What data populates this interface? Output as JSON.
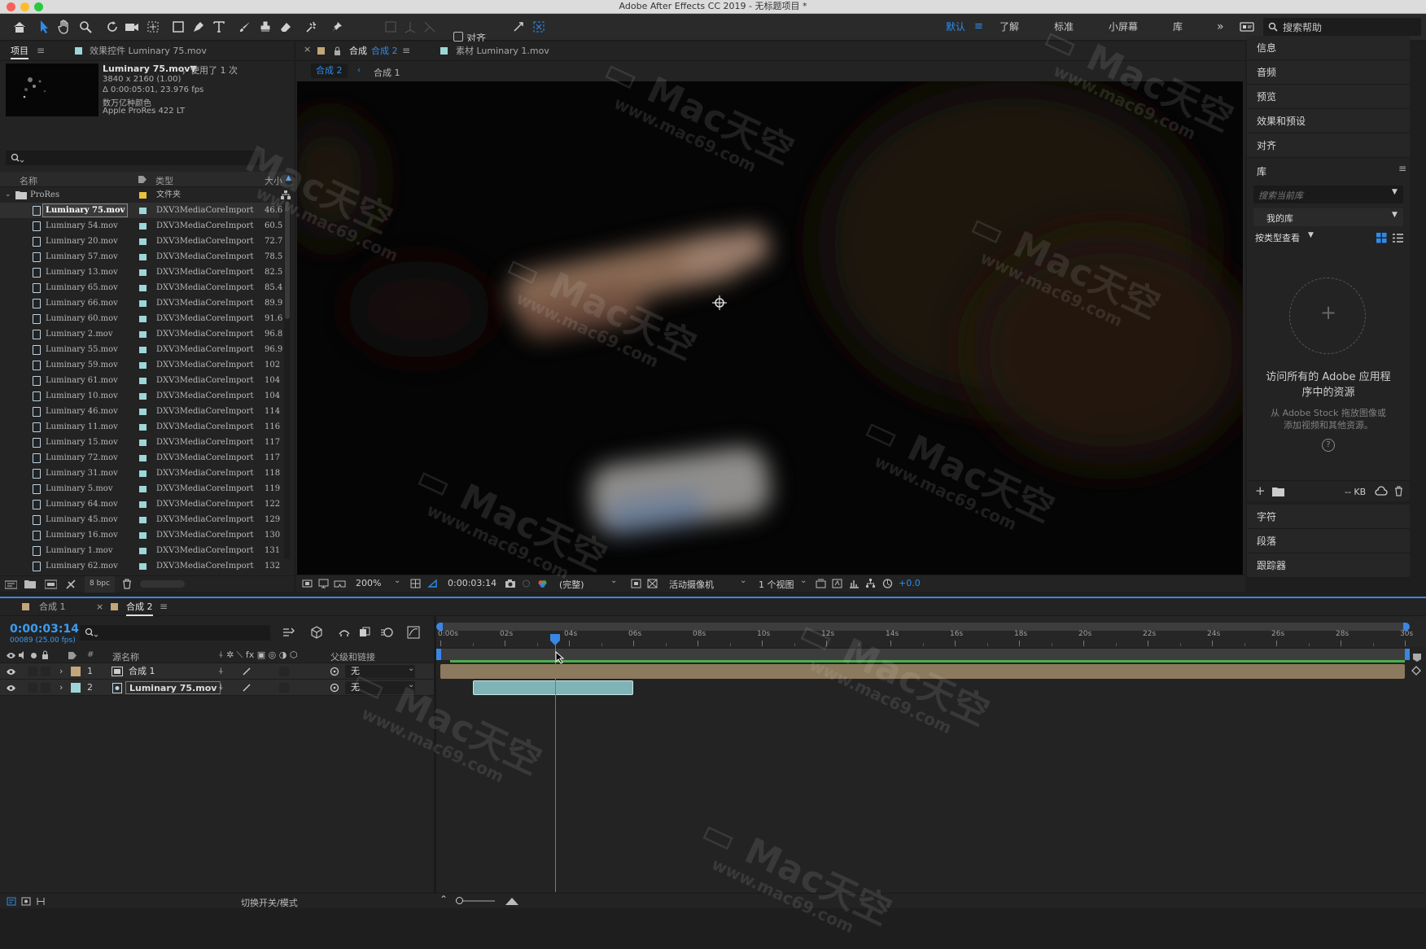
{
  "window": {
    "title": "Adobe After Effects CC 2019 - 无标题项目 *"
  },
  "colors": {
    "accent": "#2d8ceb",
    "comp_swatch": "#c2a57a",
    "footage_swatch": "#9ed6d8",
    "folder_swatch": "#e8c33a",
    "playhead": "#3a86e4",
    "work_area": "#4caf50"
  },
  "toolbar": {
    "tools": [
      "home-icon",
      "selection-tool-icon",
      "hand-tool-icon",
      "zoom-tool-icon",
      "rotate-tool-icon",
      "camera-tool-icon",
      "pan-behind-tool-icon",
      "rectangle-tool-icon",
      "pen-tool-icon",
      "type-tool-icon",
      "brush-tool-icon",
      "clone-stamp-tool-icon",
      "eraser-tool-icon",
      "roto-brush-icon",
      "puppet-pin-icon"
    ],
    "align_label": "对齐",
    "workspaces": [
      {
        "label": "默认",
        "active": true
      },
      {
        "label": "了解",
        "active": false
      },
      {
        "label": "标准",
        "active": false
      },
      {
        "label": "小屏幕",
        "active": false
      },
      {
        "label": "库",
        "active": false
      }
    ],
    "more": "»",
    "search_placeholder": "搜索帮助"
  },
  "project_panel": {
    "tab_project": "项目",
    "tab_effects": "效果控件 Luminary 75.mov",
    "preview": {
      "name": "Luminary 75.mov▼",
      "usage": "，使用了 1 次",
      "dimensions": "3840 x 2160 (1.00)",
      "duration": "Δ 0:00:05:01, 23.976 fps",
      "colors": "数万亿种颜色",
      "codec": "Apple ProRes 422 LT"
    },
    "search_placeholder": "",
    "columns": {
      "name": "名称",
      "type": "类型",
      "size": "大小"
    },
    "folder": {
      "name": "ProRes",
      "type": "文件夹"
    },
    "items": [
      {
        "name": "Luminary 75.mov",
        "type": "DXV3MediaCoreImport",
        "size": "46.6",
        "selected": true
      },
      {
        "name": "Luminary 54.mov",
        "type": "DXV3MediaCoreImport",
        "size": "60.5"
      },
      {
        "name": "Luminary 20.mov",
        "type": "DXV3MediaCoreImport",
        "size": "72.7"
      },
      {
        "name": "Luminary 57.mov",
        "type": "DXV3MediaCoreImport",
        "size": "78.5"
      },
      {
        "name": "Luminary 13.mov",
        "type": "DXV3MediaCoreImport",
        "size": "82.5"
      },
      {
        "name": "Luminary 65.mov",
        "type": "DXV3MediaCoreImport",
        "size": "85.4"
      },
      {
        "name": "Luminary 66.mov",
        "type": "DXV3MediaCoreImport",
        "size": "89.9"
      },
      {
        "name": "Luminary 60.mov",
        "type": "DXV3MediaCoreImport",
        "size": "91.6"
      },
      {
        "name": "Luminary 2.mov",
        "type": "DXV3MediaCoreImport",
        "size": "96.8"
      },
      {
        "name": "Luminary 55.mov",
        "type": "DXV3MediaCoreImport",
        "size": "96.9"
      },
      {
        "name": "Luminary 59.mov",
        "type": "DXV3MediaCoreImport",
        "size": "102"
      },
      {
        "name": "Luminary 61.mov",
        "type": "DXV3MediaCoreImport",
        "size": "104"
      },
      {
        "name": "Luminary 10.mov",
        "type": "DXV3MediaCoreImport",
        "size": "104"
      },
      {
        "name": "Luminary 46.mov",
        "type": "DXV3MediaCoreImport",
        "size": "114"
      },
      {
        "name": "Luminary 11.mov",
        "type": "DXV3MediaCoreImport",
        "size": "116"
      },
      {
        "name": "Luminary 15.mov",
        "type": "DXV3MediaCoreImport",
        "size": "117"
      },
      {
        "name": "Luminary 72.mov",
        "type": "DXV3MediaCoreImport",
        "size": "117"
      },
      {
        "name": "Luminary 31.mov",
        "type": "DXV3MediaCoreImport",
        "size": "118"
      },
      {
        "name": "Luminary 5.mov",
        "type": "DXV3MediaCoreImport",
        "size": "119"
      },
      {
        "name": "Luminary 64.mov",
        "type": "DXV3MediaCoreImport",
        "size": "122"
      },
      {
        "name": "Luminary 45.mov",
        "type": "DXV3MediaCoreImport",
        "size": "129"
      },
      {
        "name": "Luminary 16.mov",
        "type": "DXV3MediaCoreImport",
        "size": "130"
      },
      {
        "name": "Luminary 1.mov",
        "type": "DXV3MediaCoreImport",
        "size": "131"
      },
      {
        "name": "Luminary 62.mov",
        "type": "DXV3MediaCoreImport",
        "size": "132"
      }
    ],
    "bpc": "8 bpc"
  },
  "comp_viewer": {
    "tab_comp": "合成 合成 2",
    "tab_comp_prefix": "合成",
    "tab_comp_name": "合成 2",
    "tab_footage": "素材 Luminary 1.mov",
    "breadcrumb": [
      "合成 2",
      "合成 1"
    ],
    "zoom": "200%",
    "timecode": "0:00:03:14",
    "resolution": "(完整)",
    "camera": "活动摄像机",
    "views": "1 个视图",
    "exposure": "+0.0"
  },
  "right_panel": {
    "items_top": [
      "信息",
      "音频",
      "预览",
      "效果和预设",
      "对齐"
    ],
    "library": {
      "title": "库",
      "search_placeholder": "搜索当前库",
      "my_library": "我的库",
      "view_by": "按类型查看",
      "headline": "访问所有的 Adobe 应用程序中的资源",
      "sub": "从 Adobe Stock 拖放图像或添加视频和其他资源。",
      "size": "-- KB"
    },
    "items_bottom": [
      "字符",
      "段落",
      "跟踪器"
    ]
  },
  "timeline": {
    "tabs": [
      {
        "label": "合成 1",
        "active": false
      },
      {
        "label": "合成 2",
        "active": true
      }
    ],
    "timecode": "0:00:03:14",
    "frame_info": "00089 (25.00 fps)",
    "columns": {
      "num": "#",
      "source": "源名称",
      "parent": "父级和链接"
    },
    "layers": [
      {
        "num": "1",
        "name": "合成 1",
        "parent": "无",
        "type": "comp"
      },
      {
        "num": "2",
        "name": "Luminary 75.mov",
        "parent": "无",
        "type": "footage"
      }
    ],
    "ruler": [
      "0:00s",
      "02s",
      "04s",
      "06s",
      "08s",
      "10s",
      "12s",
      "14s",
      "16s",
      "18s",
      "20s",
      "22s",
      "24s",
      "26s",
      "28s",
      "30s"
    ],
    "playhead_seconds": 3.56,
    "duration_seconds": 30,
    "layer2_in": 1.0,
    "layer2_out": 6.0,
    "footer_toggle": "切换开关/模式"
  },
  "watermark": {
    "brand": "Mac天空",
    "url": "www.mac69.com"
  }
}
